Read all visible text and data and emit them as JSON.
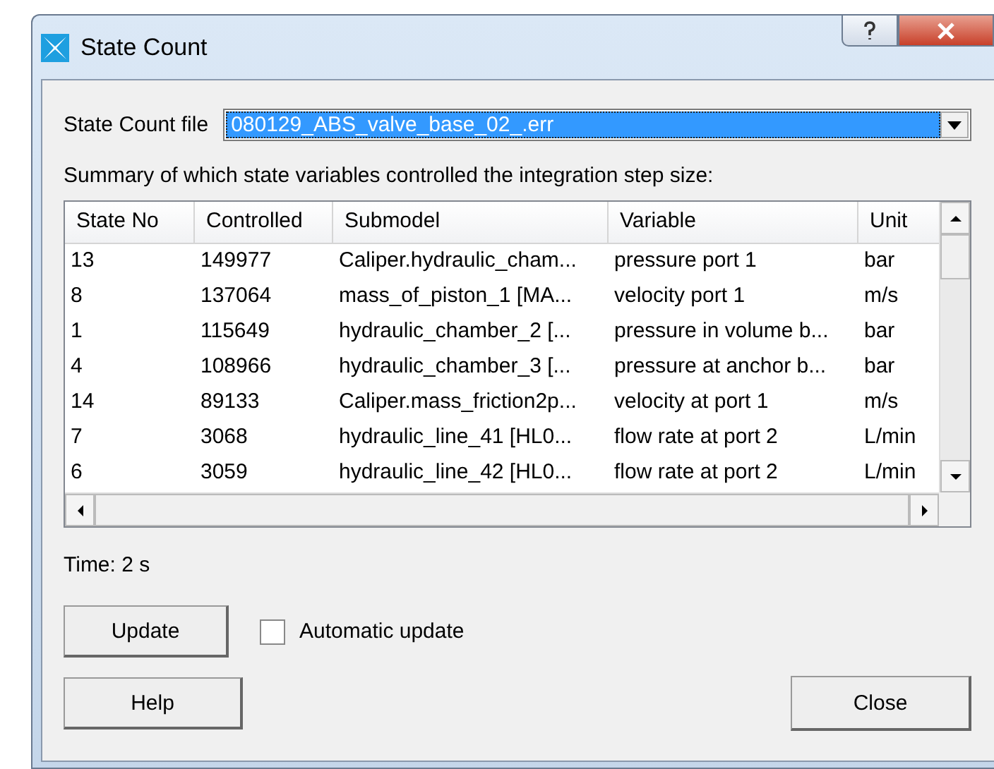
{
  "window": {
    "title": "State Count"
  },
  "file": {
    "label": "State Count file",
    "value": "080129_ABS_valve_base_02_.err"
  },
  "summary": "Summary of which state variables controlled the integration step size:",
  "table": {
    "columns": [
      "State No",
      "Controlled",
      "Submodel",
      "Variable",
      "Unit"
    ],
    "rows": [
      [
        "13",
        "149977",
        "Caliper.hydraulic_cham...",
        "pressure port 1",
        "bar"
      ],
      [
        "8",
        "137064",
        "mass_of_piston_1 [MA...",
        "velocity port 1",
        "m/s"
      ],
      [
        "1",
        "115649",
        "hydraulic_chamber_2 [...",
        "pressure in volume b...",
        "bar"
      ],
      [
        "4",
        "108966",
        "hydraulic_chamber_3 [...",
        "pressure at anchor b...",
        "bar"
      ],
      [
        "14",
        "89133",
        "Caliper.mass_friction2p...",
        "velocity at port 1",
        "m/s"
      ],
      [
        "7",
        "3068",
        "hydraulic_line_41 [HL0...",
        "flow rate at port 2",
        "L/min"
      ],
      [
        "6",
        "3059",
        "hydraulic_line_42 [HL0...",
        "flow rate at port 2",
        "L/min"
      ]
    ]
  },
  "time": "Time: 2 s",
  "update_button": "Update",
  "automatic_update": {
    "label": "Automatic update",
    "checked": false
  },
  "help_button": "Help",
  "close_button": "Close"
}
